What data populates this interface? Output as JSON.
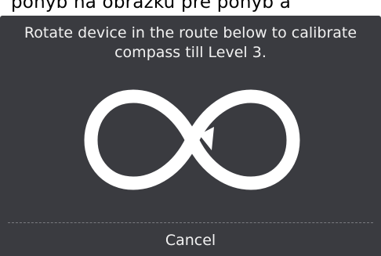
{
  "background": {
    "partial_text": "pohyb na obrázku pre pohyb a"
  },
  "dialog": {
    "message": "Rotate device in the route below to calibrate\ncompass till Level 3.",
    "route_icon": "infinity-figure-eight-icon",
    "cancel_label": "Cancel"
  },
  "colors": {
    "dialog_background": "#3a3b40",
    "text": "#f1f1f1",
    "route_stroke": "#ffffff"
  }
}
